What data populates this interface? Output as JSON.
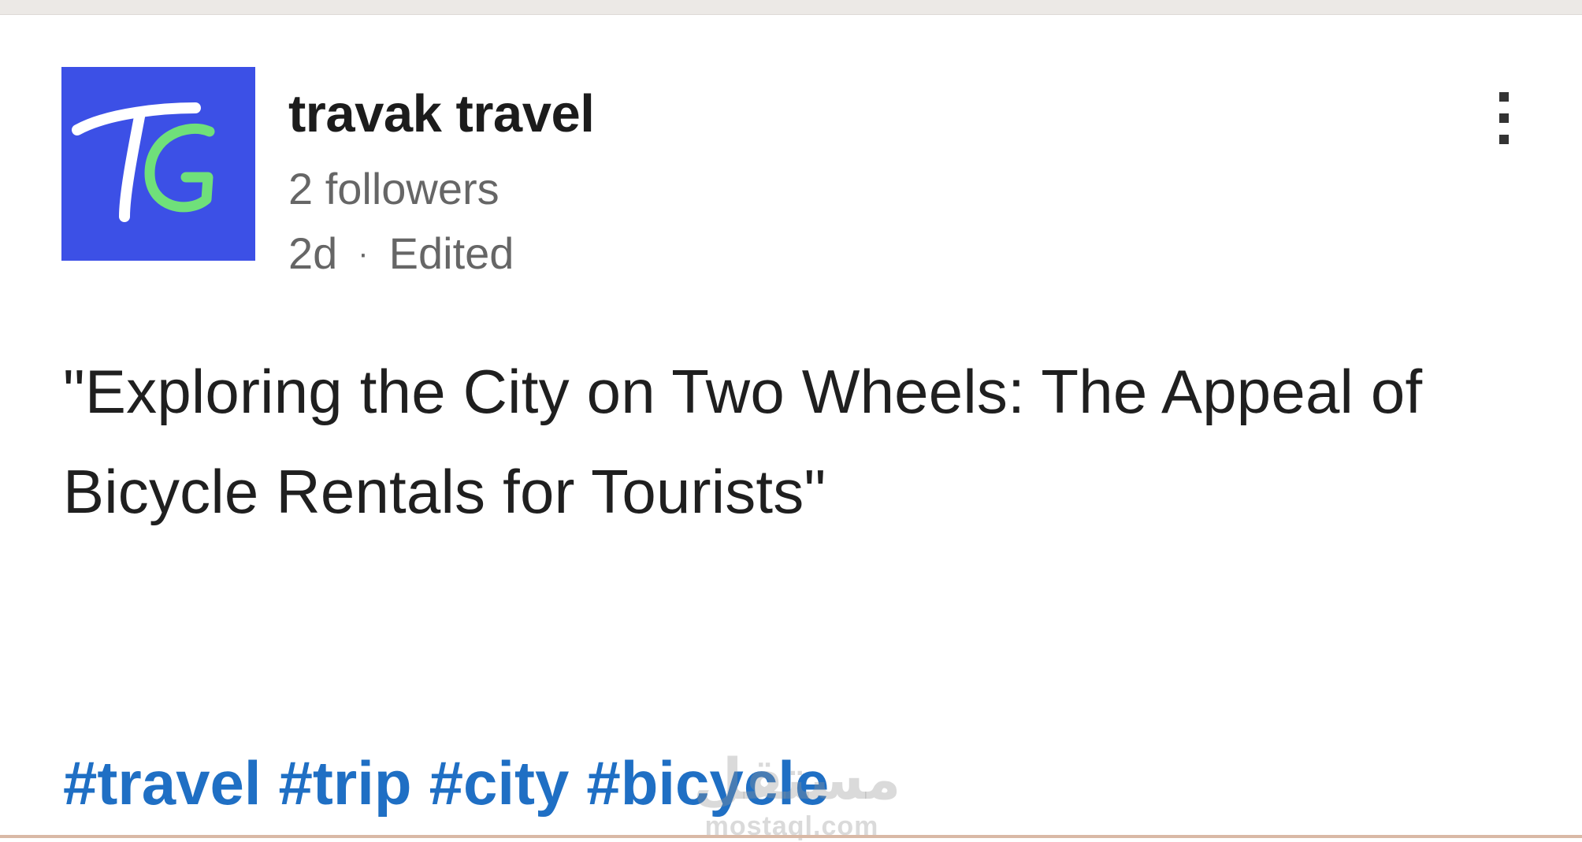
{
  "post": {
    "author": {
      "name": "travak travel",
      "followers": "2 followers",
      "logo_text": "TG",
      "logo_bg_color": "#3c50e6",
      "logo_accent_color": "#6fe07a"
    },
    "meta": {
      "age": "2d",
      "separator": "·",
      "edited": "Edited"
    },
    "more_icon": "vertical-ellipsis-icon",
    "text": "\"Exploring the City on Two Wheels: The Appeal of Bicycle Rentals for Tourists\"",
    "hashtags": [
      "#travel",
      "#trip",
      "#city",
      "#bicycle"
    ],
    "hashtag_color": "#1f6fc4"
  },
  "watermark": {
    "arabic": "مستقل",
    "url": "mostaql.com"
  }
}
